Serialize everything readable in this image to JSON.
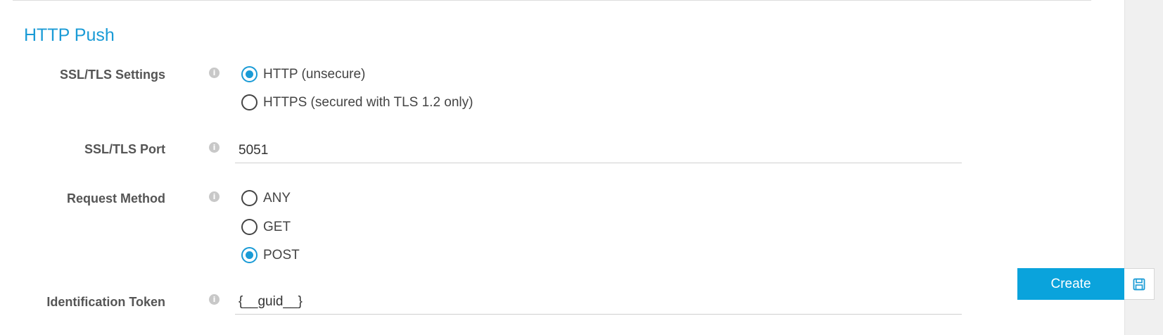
{
  "section": {
    "title": "HTTP Push"
  },
  "fields": {
    "ssl_settings": {
      "label": "SSL/TLS Settings",
      "options": [
        "HTTP (unsecure)",
        "HTTPS (secured with TLS 1.2 only)"
      ],
      "selected": "HTTP (unsecure)"
    },
    "ssl_port": {
      "label": "SSL/TLS Port",
      "value": "5051"
    },
    "request_method": {
      "label": "Request Method",
      "options": [
        "ANY",
        "GET",
        "POST"
      ],
      "selected": "POST"
    },
    "identification_token": {
      "label": "Identification Token",
      "value": "{__guid__}"
    }
  },
  "info_icon_glyph": "i",
  "actions": {
    "create_label": "Create",
    "save_icon": "floppy-disk-icon"
  },
  "colors": {
    "accent": "#1a9bd6",
    "button": "#0aa3dc",
    "panel": "#f0f0f0"
  }
}
